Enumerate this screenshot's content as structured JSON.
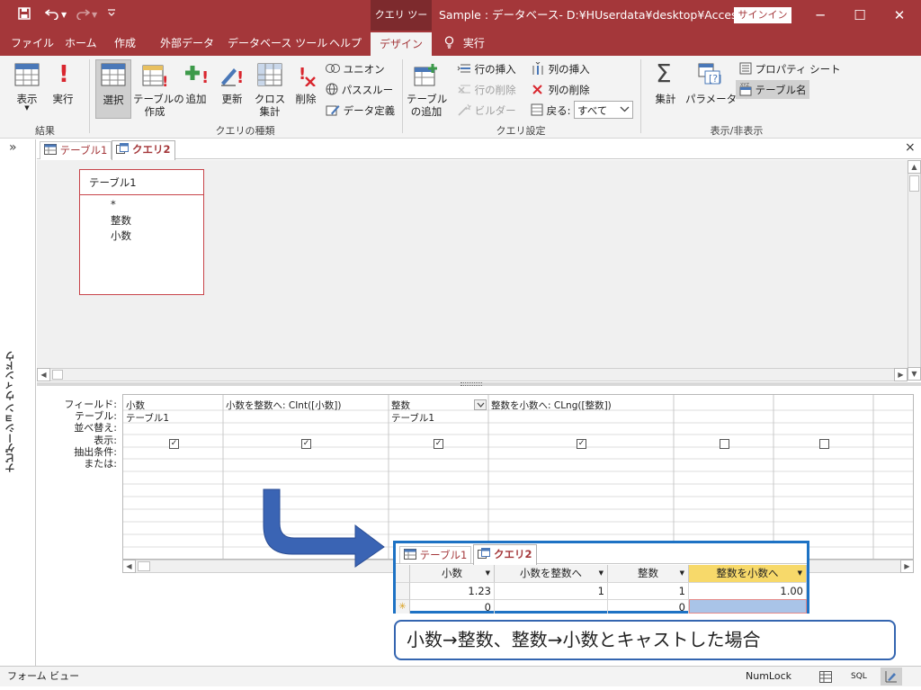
{
  "titlebar": {
    "contextual_group": "クエリ ツール",
    "document_title": "Sample : データベース- D:¥HUserdata¥desktop¥Access…",
    "signin": "サインイン",
    "save_icon": "save-icon",
    "undo_icon": "undo-icon",
    "redo_icon": "redo-icon",
    "customize_icon": "customize-quick-access-icon",
    "minimize": "─",
    "restore": "☐",
    "close": "✕"
  },
  "tabs": {
    "file": "ファイル",
    "home": "ホーム",
    "create": "作成",
    "external": "外部データ",
    "dbtools": "データベース ツール",
    "help": "ヘルプ",
    "design": "デザイン",
    "tellme": "実行"
  },
  "ribbon": {
    "view": "表示",
    "run": "実行",
    "results_group": "結果",
    "select": "選択",
    "make_table_1": "テーブルの",
    "make_table_2": "作成",
    "append": "追加",
    "update": "更新",
    "crosstab_1": "クロス",
    "crosstab_2": "集計",
    "delete": "削除",
    "union": "ユニオン",
    "passthrough": "パススルー",
    "data_definition": "データ定義",
    "query_type_group": "クエリの種類",
    "show_table_1": "テーブル",
    "show_table_2": "の追加",
    "insert_rows": "行の挿入",
    "delete_rows": "行の削除",
    "builder": "ビルダー",
    "insert_columns": "列の挿入",
    "delete_columns": "列の削除",
    "return_label": "戻る:",
    "return_value": "すべて",
    "query_setup_group": "クエリ設定",
    "totals": "集計",
    "parameters": "パラメーター",
    "property_sheet": "プロパティ シート",
    "table_names": "テーブル名",
    "show_hide_group": "表示/非表示"
  },
  "nav": {
    "collapse": "»",
    "label": "ナビゲーション ウィンドウ"
  },
  "doc_tabs": {
    "table1": "テーブル1",
    "query2": "クエリ2",
    "close": "×"
  },
  "field_list": {
    "title": "テーブル1",
    "fields": [
      "*",
      "整数",
      "小数"
    ]
  },
  "grid": {
    "row_labels": [
      "フィールド:",
      "テーブル:",
      "並べ替え:",
      "表示:",
      "抽出条件:",
      "または:"
    ],
    "columns": [
      {
        "field": "小数",
        "table": "テーブル1",
        "show": true
      },
      {
        "field": "小数を整数へ: CInt([小数])",
        "table": "",
        "show": true
      },
      {
        "field": "整数",
        "table": "テーブル1",
        "show": true
      },
      {
        "field": "整数を小数へ: CLng([整数])",
        "table": "",
        "show": true
      },
      {
        "field": "",
        "table": "",
        "show": false
      },
      {
        "field": "",
        "table": "",
        "show": false
      }
    ]
  },
  "datasheet": {
    "tab_table1": "テーブル1",
    "tab_query2": "クエリ2",
    "headers": [
      "小数",
      "小数を整数へ",
      "整数",
      "整数を小数へ"
    ],
    "row1": [
      "1.23",
      "1",
      "1",
      "1.00"
    ],
    "row2": [
      "0",
      "",
      "0",
      ""
    ],
    "new_row_marker": "✳"
  },
  "caption": "小数→整数、整数→小数とキャストした場合",
  "statusbar": {
    "left": "フォーム ビュー",
    "numlock": "NumLock",
    "sql": "SQL"
  },
  "colors": {
    "accent": "#a4373a",
    "callout_border": "#1d72c4",
    "arrow": "#3a64b4"
  }
}
